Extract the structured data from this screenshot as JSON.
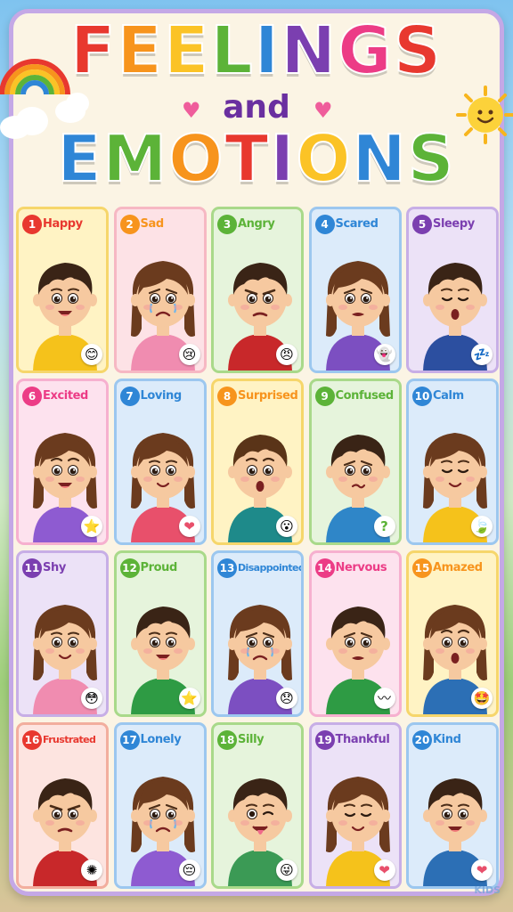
{
  "title": {
    "line1": [
      {
        "ch": "F",
        "color": "#e8382f"
      },
      {
        "ch": "E",
        "color": "#f7941d"
      },
      {
        "ch": "E",
        "color": "#fbc326"
      },
      {
        "ch": "L",
        "color": "#5cb338"
      },
      {
        "ch": "I",
        "color": "#2f86d6"
      },
      {
        "ch": "N",
        "color": "#7b3fb0"
      },
      {
        "ch": "G",
        "color": "#ec3c86"
      },
      {
        "ch": "S",
        "color": "#e8382f"
      }
    ],
    "line2": "and",
    "line3": [
      {
        "ch": "E",
        "color": "#2f86d6"
      },
      {
        "ch": "M",
        "color": "#5cb338"
      },
      {
        "ch": "O",
        "color": "#f7941d"
      },
      {
        "ch": "T",
        "color": "#e8382f"
      },
      {
        "ch": "I",
        "color": "#7b3fb0"
      },
      {
        "ch": "O",
        "color": "#fbc326"
      },
      {
        "ch": "N",
        "color": "#2f86d6"
      },
      {
        "ch": "S",
        "color": "#5cb338"
      }
    ]
  },
  "emotions": [
    {
      "num": "1",
      "label": "Happy",
      "color": "#e8382f",
      "bg": "#fff3c4",
      "border": "#f6d66b",
      "shirt": "#f5c21b",
      "hair": "#3a2416",
      "expr": "happy",
      "emoji": "😊",
      "girl": false
    },
    {
      "num": "2",
      "label": "Sad",
      "color": "#f7941d",
      "bg": "#fde2e6",
      "border": "#f6b8c3",
      "shirt": "#f08cb0",
      "hair": "#6b3b1e",
      "expr": "sad",
      "emoji": "😢",
      "girl": true
    },
    {
      "num": "3",
      "label": "Angry",
      "color": "#5cb338",
      "bg": "#e6f4dc",
      "border": "#a9d98a",
      "shirt": "#c8282a",
      "hair": "#3a2416",
      "expr": "angry",
      "emoji": "😠",
      "girl": false
    },
    {
      "num": "4",
      "label": "Scared",
      "color": "#2f86d6",
      "bg": "#dcebfa",
      "border": "#9cc7ef",
      "shirt": "#7c4fc1",
      "hair": "#6b3b1e",
      "expr": "scared",
      "emoji": "👻",
      "girl": true
    },
    {
      "num": "5",
      "label": "Sleepy",
      "color": "#7b3fb0",
      "bg": "#ece2f7",
      "border": "#c7aee6",
      "shirt": "#2c4fa0",
      "hair": "#3a2416",
      "expr": "sleepy",
      "emoji": "💤",
      "girl": false
    },
    {
      "num": "6",
      "label": "Excited",
      "color": "#ec3c86",
      "bg": "#fde2ee",
      "border": "#f6b0cf",
      "shirt": "#8e5bd1",
      "hair": "#6b3b1e",
      "expr": "excited",
      "emoji": "⭐",
      "girl": true
    },
    {
      "num": "7",
      "label": "Loving",
      "color": "#2f86d6",
      "bg": "#dcebfa",
      "border": "#9cc7ef",
      "shirt": "#e8506b",
      "hair": "#6b3b1e",
      "expr": "loving",
      "emoji": "❤",
      "girl": true
    },
    {
      "num": "8",
      "label": "Surprised",
      "color": "#f7941d",
      "bg": "#fff3c4",
      "border": "#f6d66b",
      "shirt": "#1e8a8a",
      "hair": "#5a3418",
      "expr": "surprised",
      "emoji": "😮",
      "girl": false
    },
    {
      "num": "9",
      "label": "Confused",
      "color": "#5cb338",
      "bg": "#e6f4dc",
      "border": "#a9d98a",
      "shirt": "#2f86c8",
      "hair": "#3a2416",
      "expr": "confused",
      "emoji": "?",
      "girl": false
    },
    {
      "num": "10",
      "label": "Calm",
      "color": "#2f86d6",
      "bg": "#dcebfa",
      "border": "#9cc7ef",
      "shirt": "#f5c21b",
      "hair": "#6b3b1e",
      "expr": "calm",
      "emoji": "🍃",
      "girl": true
    },
    {
      "num": "11",
      "label": "Shy",
      "color": "#7b3fb0",
      "bg": "#ece2f7",
      "border": "#c7aee6",
      "shirt": "#f08cb0",
      "hair": "#6b3b1e",
      "expr": "shy",
      "emoji": "😳",
      "girl": true
    },
    {
      "num": "12",
      "label": "Proud",
      "color": "#5cb338",
      "bg": "#e6f4dc",
      "border": "#a9d98a",
      "shirt": "#2e9b44",
      "hair": "#3a2416",
      "expr": "happy",
      "emoji": "⭐",
      "girl": false
    },
    {
      "num": "13",
      "label": "Disappointed",
      "color": "#2f86d6",
      "bg": "#dcebfa",
      "border": "#9cc7ef",
      "shirt": "#7c4fc1",
      "hair": "#6b3b1e",
      "expr": "sad",
      "emoji": "😞",
      "girl": true
    },
    {
      "num": "14",
      "label": "Nervous",
      "color": "#ec3c86",
      "bg": "#fde2ee",
      "border": "#f6b0cf",
      "shirt": "#2e9b44",
      "hair": "#3a2416",
      "expr": "scared",
      "emoji": "〰",
      "girl": false
    },
    {
      "num": "15",
      "label": "Amazed",
      "color": "#f7941d",
      "bg": "#fff3c4",
      "border": "#f6d66b",
      "shirt": "#2c6fb5",
      "hair": "#6b3b1e",
      "expr": "surprised",
      "emoji": "🤩",
      "girl": true
    },
    {
      "num": "16",
      "label": "Frustrated",
      "color": "#e8382f",
      "bg": "#fde4e0",
      "border": "#f2ae9e",
      "shirt": "#c8282a",
      "hair": "#3a2416",
      "expr": "angry",
      "emoji": "✺",
      "girl": false
    },
    {
      "num": "17",
      "label": "Lonely",
      "color": "#2f86d6",
      "bg": "#dcebfa",
      "border": "#9cc7ef",
      "shirt": "#8e5bd1",
      "hair": "#6b3b1e",
      "expr": "sad",
      "emoji": "😔",
      "girl": true
    },
    {
      "num": "18",
      "label": "Silly",
      "color": "#5cb338",
      "bg": "#e6f4dc",
      "border": "#a9d98a",
      "shirt": "#3b9a55",
      "hair": "#3a2416",
      "expr": "silly",
      "emoji": "😜",
      "girl": false
    },
    {
      "num": "19",
      "label": "Thankful",
      "color": "#7b3fb0",
      "bg": "#ece2f7",
      "border": "#c7aee6",
      "shirt": "#f5c21b",
      "hair": "#6b3b1e",
      "expr": "calm",
      "emoji": "❤",
      "girl": true
    },
    {
      "num": "20",
      "label": "Kind",
      "color": "#2f86d6",
      "bg": "#dcebfa",
      "border": "#9cc7ef",
      "shirt": "#2c6fb5",
      "hair": "#3a2416",
      "expr": "happy",
      "emoji": "❤",
      "girl": false
    }
  ],
  "watermark": "KIDS"
}
